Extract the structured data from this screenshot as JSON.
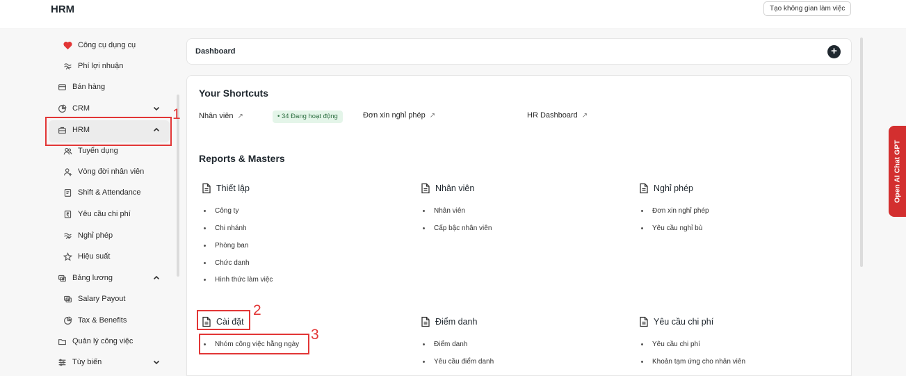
{
  "app": {
    "title": "HRM",
    "workspace_button": "Tạo không gian làm việc"
  },
  "sidebar": {
    "items": [
      {
        "label": "Công cụ dụng cụ",
        "icon": "heart-icon"
      },
      {
        "label": "Phí lợi nhuận",
        "icon": "wavy-icon"
      },
      {
        "label": "Bán hàng",
        "icon": "card-icon"
      },
      {
        "label": "CRM",
        "icon": "chart-pie-icon"
      },
      {
        "label": "HRM",
        "icon": "briefcase-icon"
      },
      {
        "label": "Tuyển dụng",
        "icon": "users-icon"
      },
      {
        "label": "Vòng đời nhân viên",
        "icon": "user-plus-icon"
      },
      {
        "label": "Shift & Attendance",
        "icon": "clipboard-icon"
      },
      {
        "label": "Yêu cầu chi phí",
        "icon": "rupee-icon"
      },
      {
        "label": "Nghỉ phép",
        "icon": "wavy-icon"
      },
      {
        "label": "Hiệu suất",
        "icon": "star-icon"
      },
      {
        "label": "Bảng lương",
        "icon": "cash-icon"
      },
      {
        "label": "Salary Payout",
        "icon": "cash-icon"
      },
      {
        "label": "Tax & Benefits",
        "icon": "chart-pie-icon"
      },
      {
        "label": "Quản lý công việc",
        "icon": "folder-icon"
      },
      {
        "label": "Tùy biến",
        "icon": "sliders-icon"
      }
    ]
  },
  "annotations": [
    "1",
    "2",
    "3"
  ],
  "dashboard": {
    "label": "Dashboard",
    "add": "+"
  },
  "shortcuts": {
    "title": "Your Shortcuts",
    "items": [
      {
        "label": "Nhân viên",
        "arrow": "↗"
      },
      {
        "label": "Đơn xin nghỉ phép",
        "arrow": "↗"
      },
      {
        "label": "HR Dashboard",
        "arrow": "↗"
      }
    ],
    "badge": "34 Đang hoạt động",
    "badge_dot": "•"
  },
  "reports": {
    "title": "Reports & Masters",
    "columns": [
      {
        "heading": "Thiết lập",
        "links": [
          "Công ty",
          "Chi nhánh",
          "Phòng ban",
          "Chức danh",
          "Hình thức làm việc"
        ]
      },
      {
        "heading": "Nhân viên",
        "links": [
          "Nhân viên",
          "Cấp bậc nhân viên"
        ]
      },
      {
        "heading": "Nghỉ phép",
        "links": [
          "Đơn xin nghỉ phép",
          "Yêu cầu nghỉ bù"
        ]
      },
      {
        "heading": "Cài đặt",
        "links": [
          "Nhóm công việc hằng ngày"
        ]
      },
      {
        "heading": "Điểm danh",
        "links": [
          "Điểm danh",
          "Yêu cầu điểm danh"
        ]
      },
      {
        "heading": "Yêu cầu chi phí",
        "links": [
          "Yêu cầu chi phí",
          "Khoản tạm ứng cho nhân viên"
        ]
      }
    ]
  },
  "gpt": {
    "label": "Open AI Chat GPT"
  },
  "colors": {
    "accent_red": "#e23636",
    "badge_bg": "#e4f5e9",
    "badge_text": "#2b6d3f",
    "gpt_tab": "#d32f2f"
  }
}
